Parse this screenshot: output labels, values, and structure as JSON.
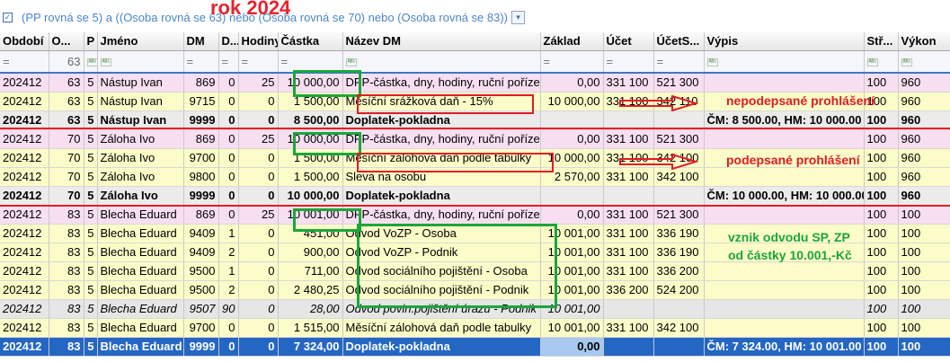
{
  "filter": {
    "text": "(PP rovná se 5) a  ((Osoba rovná se 63) nebo (Osoba rovná se 70) nebo (Osoba rovná se 83))",
    "annotation": "rok 2024"
  },
  "columns": [
    "Období",
    "O...",
    "P",
    "Jméno",
    "DM",
    "D...",
    "Hodiny",
    "Částka",
    "Název DM",
    "Základ",
    "Účet",
    "ÚčetS...",
    "Výpis",
    "Stř...",
    "Výkon"
  ],
  "filter_row": [
    "=",
    "63",
    "",
    "",
    "=",
    "=",
    "=",
    "=",
    "",
    "=",
    "=",
    "=",
    "",
    "",
    ""
  ],
  "rows": [
    {
      "style": "pink",
      "cells": [
        "202412",
        "63",
        "5",
        "Nástup Ivan",
        "869",
        "0",
        "25",
        "10 000,00",
        "DPP-částka, dny, hodiny, ruční pořízení",
        "0,00",
        "331 100",
        "521 300",
        "",
        "100",
        "960"
      ]
    },
    {
      "style": "yellow",
      "cells": [
        "202412",
        "63",
        "5",
        "Nástup Ivan",
        "9715",
        "0",
        "0",
        "1 500,00",
        "Měsíční srážková daň - 15%",
        "10 000,00",
        "331 100",
        "342 110",
        "",
        "100",
        "960"
      ]
    },
    {
      "style": "gray",
      "cells": [
        "202412",
        "63",
        "5",
        "Nástup Ivan",
        "9999",
        "0",
        "0",
        "8 500,00",
        "Doplatek-pokladna",
        "",
        "",
        "",
        "ČM: 8 500.00, HM: 10 000.00",
        "100",
        "960"
      ]
    },
    {
      "style": "pink",
      "cells": [
        "202412",
        "70",
        "5",
        "Záloha Ivo",
        "869",
        "0",
        "25",
        "10 000,00",
        "DPP-částka, dny, hodiny, ruční pořízení",
        "0,00",
        "331 100",
        "521 300",
        "",
        "100",
        "960"
      ]
    },
    {
      "style": "yellow",
      "cells": [
        "202412",
        "70",
        "5",
        "Záloha Ivo",
        "9700",
        "0",
        "0",
        "1 500,00",
        "Měsíční zálohová daň podle tabulky",
        "10 000,00",
        "331 100",
        "342 100",
        "",
        "100",
        "960"
      ]
    },
    {
      "style": "yellow",
      "cells": [
        "202412",
        "70",
        "5",
        "Záloha Ivo",
        "9800",
        "0",
        "0",
        "1 500,00",
        "Sleva na osobu",
        "2 570,00",
        "331 100",
        "342 100",
        "",
        "100",
        "960"
      ]
    },
    {
      "style": "gray",
      "cells": [
        "202412",
        "70",
        "5",
        "Záloha Ivo",
        "9999",
        "0",
        "0",
        "10 000,00",
        "Doplatek-pokladna",
        "",
        "",
        "",
        "ČM: 10 000.00, HM: 10 000.00",
        "100",
        "960"
      ]
    },
    {
      "style": "pink",
      "cells": [
        "202412",
        "83",
        "5",
        "Blecha Eduard",
        "869",
        "0",
        "25",
        "10 001,00",
        "DPP-částka, dny, hodiny, ruční pořízení",
        "0,00",
        "331 100",
        "521 300",
        "",
        "100",
        "100"
      ]
    },
    {
      "style": "yellow",
      "cells": [
        "202412",
        "83",
        "5",
        "Blecha Eduard",
        "9409",
        "1",
        "0",
        "451,00",
        "Odvod VoZP - Osoba",
        "10 001,00",
        "331 100",
        "336 190",
        "",
        "100",
        "100"
      ]
    },
    {
      "style": "yellow",
      "cells": [
        "202412",
        "83",
        "5",
        "Blecha Eduard",
        "9409",
        "2",
        "0",
        "900,00",
        "Odvod VoZP - Podnik",
        "10 001,00",
        "331 100",
        "336 190",
        "",
        "100",
        "100"
      ]
    },
    {
      "style": "yellow",
      "cells": [
        "202412",
        "83",
        "5",
        "Blecha Eduard",
        "9500",
        "1",
        "0",
        "711,00",
        "Odvod sociálního pojištění - Osoba",
        "10 001,00",
        "331 100",
        "336 200",
        "",
        "100",
        "100"
      ]
    },
    {
      "style": "yellow",
      "cells": [
        "202412",
        "83",
        "5",
        "Blecha Eduard",
        "9500",
        "2",
        "0",
        "2 480,25",
        "Odvod sociálního pojištění - Podnik",
        "10 001,00",
        "336 200",
        "524 200",
        "",
        "100",
        "100"
      ]
    },
    {
      "style": "gray2",
      "cells": [
        "202412",
        "83",
        "5",
        "Blecha Eduard",
        "9507",
        "90",
        "0",
        "28,00",
        "Odvod povin.pojištění úrazu - Podnik",
        "10 001,00",
        "",
        "",
        "",
        "100",
        "100"
      ]
    },
    {
      "style": "yellow",
      "cells": [
        "202412",
        "83",
        "5",
        "Blecha Eduard",
        "9700",
        "0",
        "0",
        "1 515,00",
        "Měsíční zálohová daň podle tabulky",
        "10 001,00",
        "331 100",
        "342 100",
        "",
        "100",
        "100"
      ]
    },
    {
      "style": "sel",
      "cells": [
        "202412",
        "83",
        "5",
        "Blecha Eduard",
        "9999",
        "0",
        "0",
        "7 324,00",
        "Doplatek-pokladna",
        "0,00",
        "",
        "",
        "ČM: 7 324.00, HM: 10 001.00",
        "100",
        "100"
      ]
    }
  ],
  "annotations": {
    "note1": "nepodepsané prohlášení",
    "note2": "podepsané prohlášení",
    "note3_line1": "vznik odvodu SP, ZP",
    "note3_line2": "od částky 10.001,-Kč"
  },
  "colors": {
    "red": "#e01b26",
    "green": "#1ba63a",
    "selected": "#2466c4"
  }
}
